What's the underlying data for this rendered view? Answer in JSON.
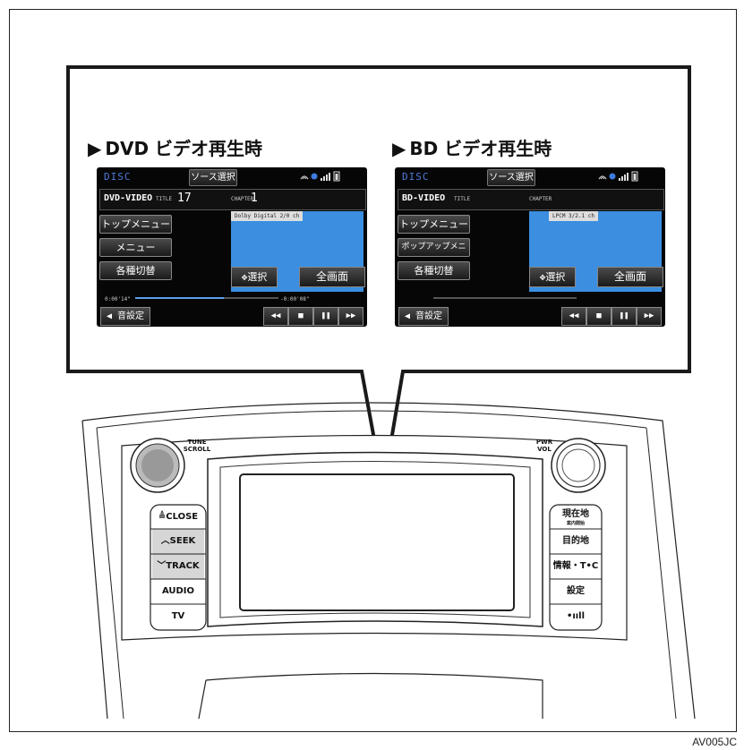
{
  "figure_code": "AV005JC",
  "panels": [
    {
      "heading": "DVD ビデオ再生時",
      "screen": {
        "disc_label": "DISC",
        "source_button": "ソース選択",
        "format": "DVD-VIDEO",
        "title_label": "TITLE",
        "title_number": "17",
        "chapter_label": "CHAPTER",
        "chapter_number": "1",
        "audio_info": "Dolby Digital  2/0  ch",
        "menu_buttons": [
          "トップメニュー",
          "メニュー",
          "各種切替"
        ],
        "select_button": "選択",
        "fullscreen_button": "全画面",
        "elapsed_time": "0:00'14\"",
        "remaining_time": "-0:00'08\"",
        "progress": 0.62,
        "sound_button": "音設定",
        "controls": [
          "◀◀",
          "■",
          "❚❚",
          "▶▶"
        ]
      }
    },
    {
      "heading": "BD ビデオ再生時",
      "screen": {
        "disc_label": "DISC",
        "source_button": "ソース選択",
        "format": "BD-VIDEO",
        "title_label": "TITLE",
        "title_number": "",
        "chapter_label": "CHAPTER",
        "chapter_number": "",
        "audio_info": "LPCM  3/2.1  ch",
        "menu_buttons": [
          "トップメニュー",
          "ポップアップメニュー",
          "各種切替"
        ],
        "select_button": "選択",
        "fullscreen_button": "全画面",
        "elapsed_time": "",
        "remaining_time": "",
        "progress": 0,
        "sound_button": "音設定",
        "controls": [
          "◀◀",
          "■",
          "❚❚",
          "▶▶"
        ]
      }
    }
  ],
  "console": {
    "left_knob_label": "TUNE SCROLL",
    "right_knob_label": "PWR VOL",
    "left_buttons": [
      "≜CLOSE",
      "︿SEEK",
      "﹀TRACK",
      "AUDIO",
      "TV"
    ],
    "right_buttons": [
      "現在地",
      "目的地",
      "情報・T•C",
      "設定",
      "•ııll"
    ],
    "right_top_sub": "案内開始"
  },
  "colors": {
    "screen_bg": "#060606",
    "video_area": "#3b8ee0",
    "disc_label": "#4f7bd8",
    "console_button_grey": "#d6d6d6"
  }
}
